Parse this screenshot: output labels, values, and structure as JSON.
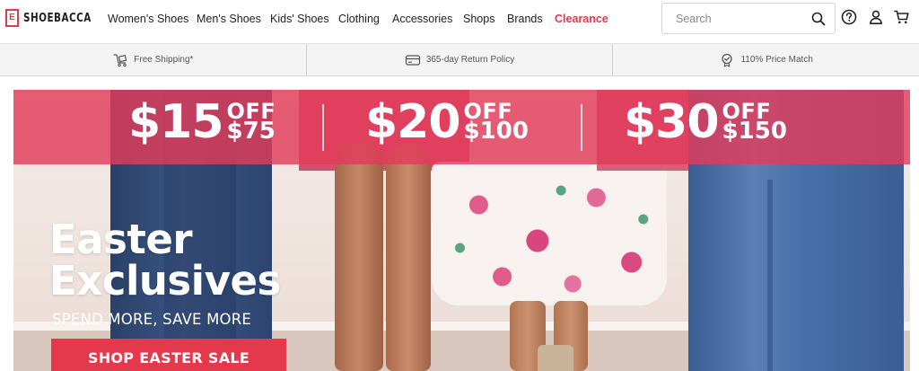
{
  "brand": {
    "logo_mark": "E",
    "name": "SHOEBACCA"
  },
  "nav": {
    "items": [
      {
        "label": "Women's Shoes"
      },
      {
        "label": "Men's Shoes"
      },
      {
        "label": "Kids' Shoes"
      },
      {
        "label": "Clothing"
      },
      {
        "label": "Accessories"
      },
      {
        "label": "Shops"
      },
      {
        "label": "Brands"
      },
      {
        "label": "Clearance"
      }
    ]
  },
  "search": {
    "placeholder": "Search",
    "icon": "search-icon"
  },
  "header_icons": [
    "help-icon",
    "account-icon",
    "cart-icon"
  ],
  "benefits": [
    {
      "label": "Free Shipping*",
      "icon": "free-shipping-icon"
    },
    {
      "label": "365-day Return Policy",
      "icon": "card-return-icon"
    },
    {
      "label": "110% Price Match",
      "icon": "price-match-icon"
    }
  ],
  "hero": {
    "offers": [
      {
        "amount": "$15",
        "off": "OFF",
        "min": "$75"
      },
      {
        "amount": "$20",
        "off": "OFF",
        "min": "$100"
      },
      {
        "amount": "$30",
        "off": "OFF",
        "min": "$150"
      }
    ],
    "title_line1": "Easter",
    "title_line2": "Exclusives",
    "subtitle": "SPEND MORE, SAVE MORE",
    "cta": "SHOP EASTER SALE"
  },
  "colors": {
    "accent": "#e4394c",
    "promo_band": "#e23c5a",
    "benefits_bg": "#f4f4f4"
  }
}
